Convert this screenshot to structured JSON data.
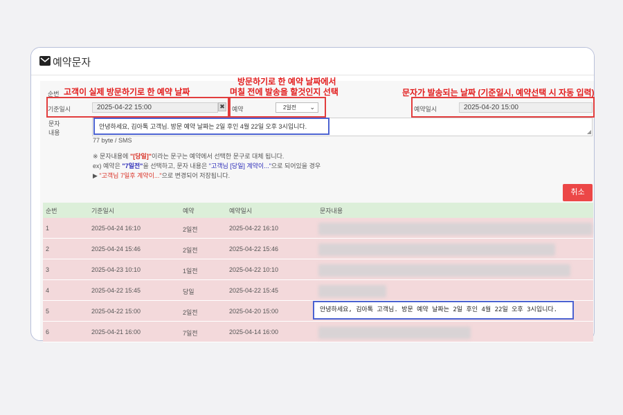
{
  "window": {
    "title": "예약문자"
  },
  "form": {
    "seq_label": "순번",
    "base_date_label": "기준일시",
    "base_date_value": "2025-04-22 15:00",
    "clear_glyph": "✖",
    "reservation_label": "예약",
    "reservation_selected": "2일전",
    "chevron_glyph": "⌄",
    "send_date_label": "예약일시",
    "send_date_value": "2025-04-20 15:00",
    "message_label_1": "문자",
    "message_label_2": "내용",
    "message_text": "안녕하세요, 김아톡 고객님. 방문 예약 날짜는 2일 후인 4월 22일 오후 3시입니다.",
    "byte_count": "77 byte / SMS",
    "notes": {
      "line1_a": "※ 문자내용에 ",
      "line1_b": "\"[당일]\"",
      "line1_c": "이라는 문구는 예약에서 선택한 문구로 대체 됩니다.",
      "line2_a": "ex) 예약은 ",
      "line2_b": "\"7일전\"",
      "line2_c": "을 선택하고, 문자 내용은 ",
      "line2_d": "\"고객님 [당일] 계약이...\"",
      "line2_e": "으로 되어있을 경우",
      "line3_a": "▶ ",
      "line3_b": "\"고객님 7일후 계약이...\"",
      "line3_c": "으로 변경되어 저장됩니다."
    },
    "cancel_label": "취소"
  },
  "annotations": {
    "base_date": "고객이 실제 방문하기로 한 예약 날짜",
    "reservation_1": "방문하기로 한 예약 날짜에서",
    "reservation_2": "며칠 전에 발송을 할것인지 선택",
    "send_date": "문자가 발송되는 날짜  (기준일시, 예약선택 시 자동 입력)"
  },
  "table": {
    "headers": [
      "순번",
      "기준일시",
      "예약",
      "예약일시",
      "문자내용"
    ],
    "rows": [
      {
        "seq": "1",
        "base": "2025-04-24 16:10",
        "res": "2일전",
        "send": "2025-04-22 16:10"
      },
      {
        "seq": "2",
        "base": "2025-04-24 15:46",
        "res": "2일전",
        "send": "2025-04-22 15:46"
      },
      {
        "seq": "3",
        "base": "2025-04-23 10:10",
        "res": "1일전",
        "send": "2025-04-22 10:10"
      },
      {
        "seq": "4",
        "base": "2025-04-22 15:45",
        "res": "당일",
        "send": "2025-04-22 15:45"
      },
      {
        "seq": "5",
        "base": "2025-04-22 15:00",
        "res": "2일전",
        "send": "2025-04-20 15:00"
      },
      {
        "seq": "6",
        "base": "2025-04-21 16:00",
        "res": "7일전",
        "send": "2025-04-14 16:00"
      }
    ],
    "popup_message": "안녕하세요, 김아톡 고객님. 방문 예약 날짜는 2일 후인 4월 22일 오후 3시입니다."
  },
  "colors": {
    "annotation_red": "#e23c3c",
    "annotation_blue": "#4b62d1",
    "row_bg": "#f3d9db",
    "header_bg": "#dcefd9",
    "cancel_bg": "#ec4747"
  }
}
